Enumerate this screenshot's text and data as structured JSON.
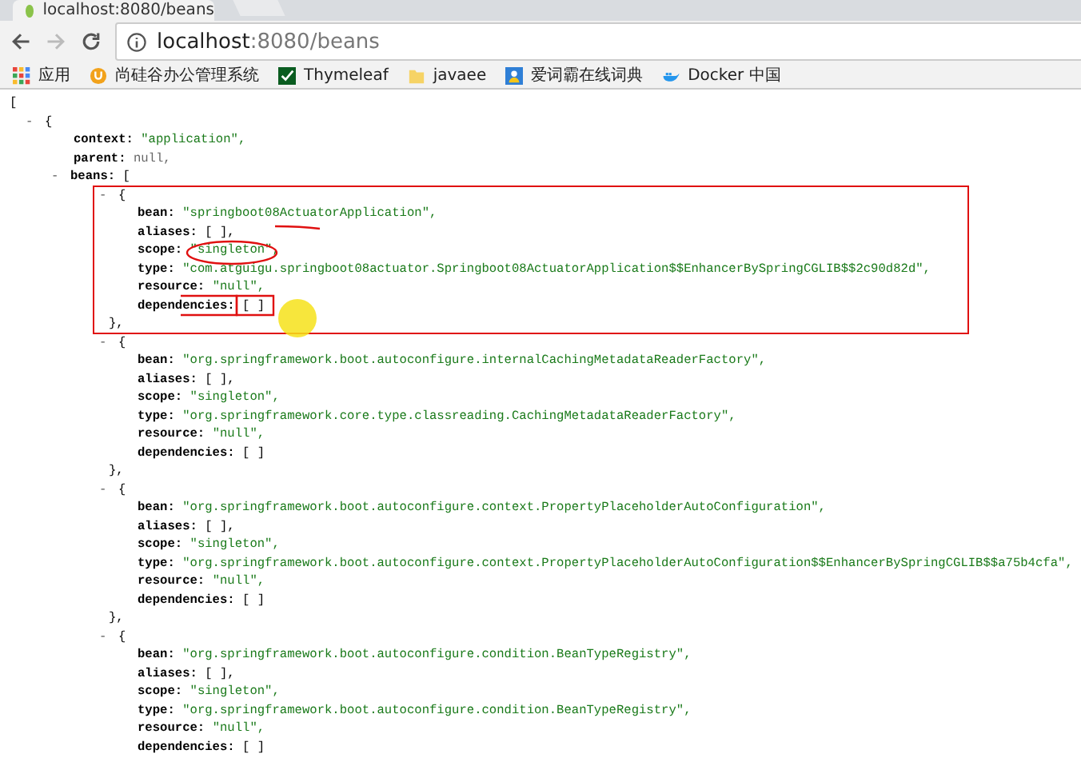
{
  "tab": {
    "title": "localhost:8080/beans"
  },
  "address_bar": {
    "host": "localhost",
    "path": ":8080/beans"
  },
  "bookmarks": [
    {
      "label": "应用",
      "kind": "apps"
    },
    {
      "label": "尚硅谷办公管理系统",
      "kind": "site"
    },
    {
      "label": "Thymeleaf",
      "kind": "check"
    },
    {
      "label": "javaee",
      "kind": "folder"
    },
    {
      "label": "爱词霸在线词典",
      "kind": "person"
    },
    {
      "label": "Docker 中国",
      "kind": "whale"
    }
  ],
  "json_view": {
    "open": "[",
    "root": {
      "toggle": "-",
      "open": "{",
      "fields": [
        {
          "key": "context:",
          "value": "\"application\",",
          "kind": "string"
        },
        {
          "key": "parent:",
          "value": "null,",
          "kind": "null"
        }
      ],
      "beans": {
        "toggle": "-",
        "key": "beans:",
        "open": "[",
        "items": [
          {
            "toggle": "-",
            "open": "{",
            "close": "},",
            "fields": [
              {
                "key": "bean:",
                "value": "\"springboot08ActuatorApplication\",",
                "kind": "string"
              },
              {
                "key": "aliases:",
                "value": "[ ],",
                "kind": "array"
              },
              {
                "key": "scope:",
                "value": "\"singleton\",",
                "kind": "string"
              },
              {
                "key": "type:",
                "value": "\"com.atguigu.springboot08actuator.Springboot08ActuatorApplication$$EnhancerBySpringCGLIB$$2c90d82d\",",
                "kind": "string"
              },
              {
                "key": "resource:",
                "value": "\"null\",",
                "kind": "string"
              },
              {
                "key": "dependencies:",
                "value": "[ ]",
                "kind": "array"
              }
            ]
          },
          {
            "toggle": "-",
            "open": "{",
            "close": "},",
            "fields": [
              {
                "key": "bean:",
                "value": "\"org.springframework.boot.autoconfigure.internalCachingMetadataReaderFactory\",",
                "kind": "string"
              },
              {
                "key": "aliases:",
                "value": "[ ],",
                "kind": "array"
              },
              {
                "key": "scope:",
                "value": "\"singleton\",",
                "kind": "string"
              },
              {
                "key": "type:",
                "value": "\"org.springframework.core.type.classreading.CachingMetadataReaderFactory\",",
                "kind": "string"
              },
              {
                "key": "resource:",
                "value": "\"null\",",
                "kind": "string"
              },
              {
                "key": "dependencies:",
                "value": "[ ]",
                "kind": "array"
              }
            ]
          },
          {
            "toggle": "-",
            "open": "{",
            "close": "},",
            "fields": [
              {
                "key": "bean:",
                "value": "\"org.springframework.boot.autoconfigure.context.PropertyPlaceholderAutoConfiguration\",",
                "kind": "string"
              },
              {
                "key": "aliases:",
                "value": "[ ],",
                "kind": "array"
              },
              {
                "key": "scope:",
                "value": "\"singleton\",",
                "kind": "string"
              },
              {
                "key": "type:",
                "value": "\"org.springframework.boot.autoconfigure.context.PropertyPlaceholderAutoConfiguration$$EnhancerBySpringCGLIB$$a75b4cfa\",",
                "kind": "string"
              },
              {
                "key": "resource:",
                "value": "\"null\",",
                "kind": "string"
              },
              {
                "key": "dependencies:",
                "value": "[ ]",
                "kind": "array"
              }
            ]
          },
          {
            "toggle": "-",
            "open": "{",
            "fields": [
              {
                "key": "bean:",
                "value": "\"org.springframework.boot.autoconfigure.condition.BeanTypeRegistry\",",
                "kind": "string"
              },
              {
                "key": "aliases:",
                "value": "[ ],",
                "kind": "array"
              },
              {
                "key": "scope:",
                "value": "\"singleton\",",
                "kind": "string"
              },
              {
                "key": "type:",
                "value": "\"org.springframework.boot.autoconfigure.condition.BeanTypeRegistry\",",
                "kind": "string"
              },
              {
                "key": "resource:",
                "value": "\"null\",",
                "kind": "string"
              },
              {
                "key": "dependencies:",
                "value": "[ ]",
                "kind": "array"
              }
            ]
          }
        ]
      }
    }
  }
}
